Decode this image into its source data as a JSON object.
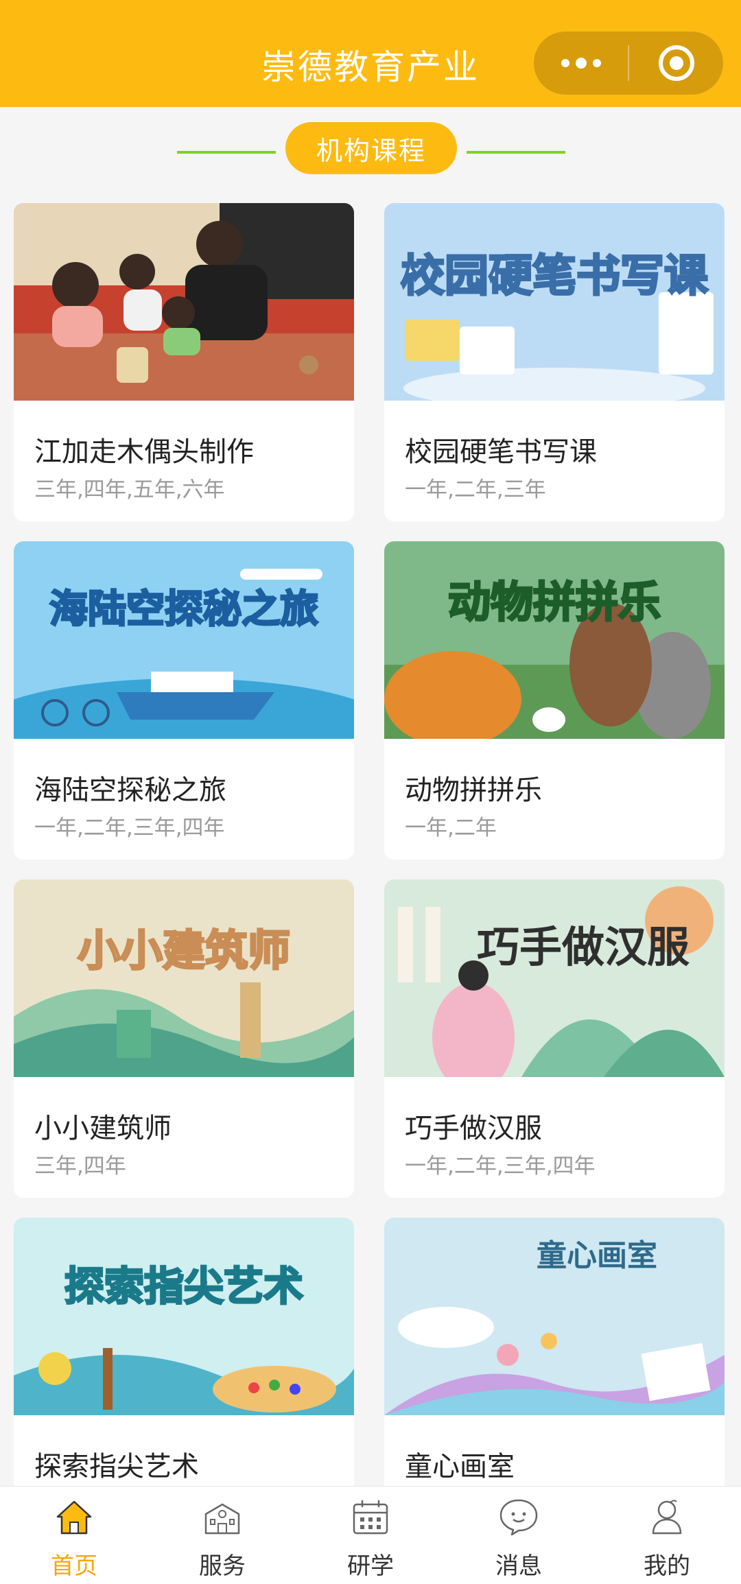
{
  "header": {
    "title": "崇德教育产业"
  },
  "section": {
    "title": "机构课程"
  },
  "courses": [
    {
      "name": "江加走木偶头制作",
      "grades": "三年,四年,五年,六年",
      "banner": ""
    },
    {
      "name": "校园硬笔书写课",
      "grades": "一年,二年,三年",
      "banner": "校园硬笔书写课"
    },
    {
      "name": "海陆空探秘之旅",
      "grades": "一年,二年,三年,四年",
      "banner": "海陆空探秘之旅"
    },
    {
      "name": "动物拼拼乐",
      "grades": "一年,二年",
      "banner": "动物拼拼乐"
    },
    {
      "name": "小小建筑师",
      "grades": "三年,四年",
      "banner": "小小建筑师"
    },
    {
      "name": "巧手做汉服",
      "grades": "一年,二年,三年,四年",
      "banner": "巧手做汉服"
    },
    {
      "name": "探索指尖艺术",
      "grades": "",
      "banner": "探索指尖艺术"
    },
    {
      "name": "童心画室",
      "grades": "",
      "banner": "童心画室"
    }
  ],
  "tabbar": {
    "items": [
      {
        "label": "首页",
        "icon": "home-icon",
        "active": true
      },
      {
        "label": "服务",
        "icon": "building-icon",
        "active": false
      },
      {
        "label": "研学",
        "icon": "calendar-icon",
        "active": false
      },
      {
        "label": "消息",
        "icon": "chat-icon",
        "active": false
      },
      {
        "label": "我的",
        "icon": "user-icon",
        "active": false
      }
    ]
  },
  "colors": {
    "accent": "#fdbb12",
    "active_tab": "#f5a70a",
    "section_line": "#7ed321"
  }
}
